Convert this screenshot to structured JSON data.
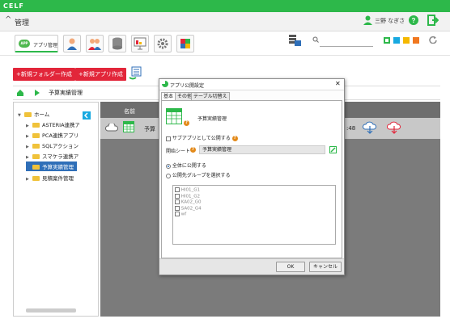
{
  "app": {
    "logo": "CELF",
    "title": "管理",
    "user": "三野 なぎさ"
  },
  "toolbar": {
    "app_tab": "アプリ管理",
    "app_badge": "APP",
    "tabs": [
      "user-icon",
      "group-icon",
      "database-icon",
      "presentation-icon",
      "gear-icon",
      "plugin-icon"
    ],
    "swatches": [
      "#2db84a",
      "#18a9e0",
      "#f5b800",
      "#f07820"
    ]
  },
  "actions": {
    "new_folder": "+新規フォルダー作成",
    "new_app": "+新規アプリ作成"
  },
  "breadcrumb": {
    "current": "予算実績管理"
  },
  "tree": {
    "items": [
      {
        "label": "ホーム",
        "level": 0,
        "expanded": true
      },
      {
        "label": "ASTERIA連携ア",
        "level": 1
      },
      {
        "label": "PCA連携アプリ",
        "level": 1
      },
      {
        "label": "SQLアクション",
        "level": 1
      },
      {
        "label": "スマケラ連携アプ",
        "level": 1
      },
      {
        "label": "予算実績管理",
        "level": 1,
        "selected": true
      },
      {
        "label": "見積案件管理",
        "level": 1
      }
    ]
  },
  "main": {
    "column_name": "名前",
    "row_name": "予算",
    "row_time": ":48"
  },
  "dialog": {
    "title": "アプリ公開設定",
    "tabs": [
      "基本",
      "その他",
      "テーブル切替え"
    ],
    "app_name": "予算実績管理",
    "sub_app_label": "サブアプリとして公開する",
    "start_sheet_label": "開始シート",
    "start_sheet_value": "予算実績管理",
    "radio_all": "全体に公開する",
    "radio_group": "公開先グループを選択する",
    "groups": [
      "HI01_G1",
      "HI01_G2",
      "KA02_G0",
      "SA02_G4",
      "wf"
    ],
    "ok": "OK",
    "cancel": "キャンセル"
  }
}
